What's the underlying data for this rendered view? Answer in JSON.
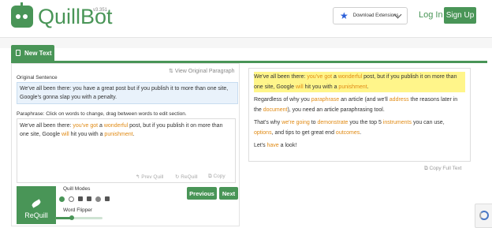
{
  "header": {
    "brand": "QuillBot",
    "version": "v3.351",
    "download_label": "Download Extensions",
    "login_label": "Log In",
    "signup_label": "Sign Up"
  },
  "tab": {
    "new_text_label": "New Text"
  },
  "left": {
    "view_original_label": "View Original Paragraph",
    "original_label": "Original Sentence",
    "original_text": "We've all been there: you have a great post but if you publish it to more than one site, Google's gonna slap you with a penalty.",
    "paraphrase_label": "Paraphrase: Click on words to change, drag between words to edit section.",
    "paraphrase_segments": [
      {
        "text": "We've all been there: ",
        "kind": "plain"
      },
      {
        "text": "you've got",
        "kind": "changed"
      },
      {
        "text": " a ",
        "kind": "plain"
      },
      {
        "text": "wonderful",
        "kind": "changed"
      },
      {
        "text": " post, but if you publish it on more than one site, Google ",
        "kind": "plain"
      },
      {
        "text": "will",
        "kind": "changed"
      },
      {
        "text": " hit you with a ",
        "kind": "plain"
      },
      {
        "text": "punishment",
        "kind": "changed"
      },
      {
        "text": ".",
        "kind": "plain"
      }
    ],
    "tools": {
      "prev_quill": "Prev Quill",
      "requill": "ReQuill",
      "copy": "Copy"
    },
    "requill_button": "ReQuill",
    "quill_modes_label": "Quill Modes",
    "word_flipper_label": "Word Flipper",
    "word_flipper_level": 0.35,
    "prev_button": "Previous",
    "next_button": "Next"
  },
  "right": {
    "paragraphs": [
      [
        {
          "text": "We've all been there: ",
          "kind": "plain"
        },
        {
          "text": "you've got",
          "kind": "changed"
        },
        {
          "text": " a ",
          "kind": "plain"
        },
        {
          "text": "wonderful",
          "kind": "changed"
        },
        {
          "text": " post, but if you publish it on more than one site, Google ",
          "kind": "plain"
        },
        {
          "text": "will",
          "kind": "changed"
        },
        {
          "text": " hit you with a ",
          "kind": "plain"
        },
        {
          "text": "punishment",
          "kind": "changed"
        },
        {
          "text": ".",
          "kind": "plain"
        }
      ],
      [
        {
          "text": "Regardless of why you ",
          "kind": "plain"
        },
        {
          "text": "paraphrase",
          "kind": "changed"
        },
        {
          "text": " an article (and we'll ",
          "kind": "plain"
        },
        {
          "text": "address",
          "kind": "changed"
        },
        {
          "text": " the reasons later in the ",
          "kind": "plain"
        },
        {
          "text": "document",
          "kind": "changed"
        },
        {
          "text": "), you need an article paraphrasing tool.",
          "kind": "plain"
        }
      ],
      [
        {
          "text": "That's why ",
          "kind": "plain"
        },
        {
          "text": "we're going",
          "kind": "changed"
        },
        {
          "text": " to ",
          "kind": "plain"
        },
        {
          "text": "demonstrate",
          "kind": "changed"
        },
        {
          "text": " you the top 5 ",
          "kind": "plain"
        },
        {
          "text": "instruments",
          "kind": "changed"
        },
        {
          "text": " you can use, ",
          "kind": "plain"
        },
        {
          "text": "options",
          "kind": "changed"
        },
        {
          "text": ", and tips to get great end ",
          "kind": "plain"
        },
        {
          "text": "outcomes",
          "kind": "changed"
        },
        {
          "text": ".",
          "kind": "plain"
        }
      ],
      [
        {
          "text": " Let's ",
          "kind": "plain"
        },
        {
          "text": "have",
          "kind": "changed"
        },
        {
          "text": " a look!",
          "kind": "plain"
        }
      ]
    ],
    "copy_full_label": "Copy Full Text"
  }
}
